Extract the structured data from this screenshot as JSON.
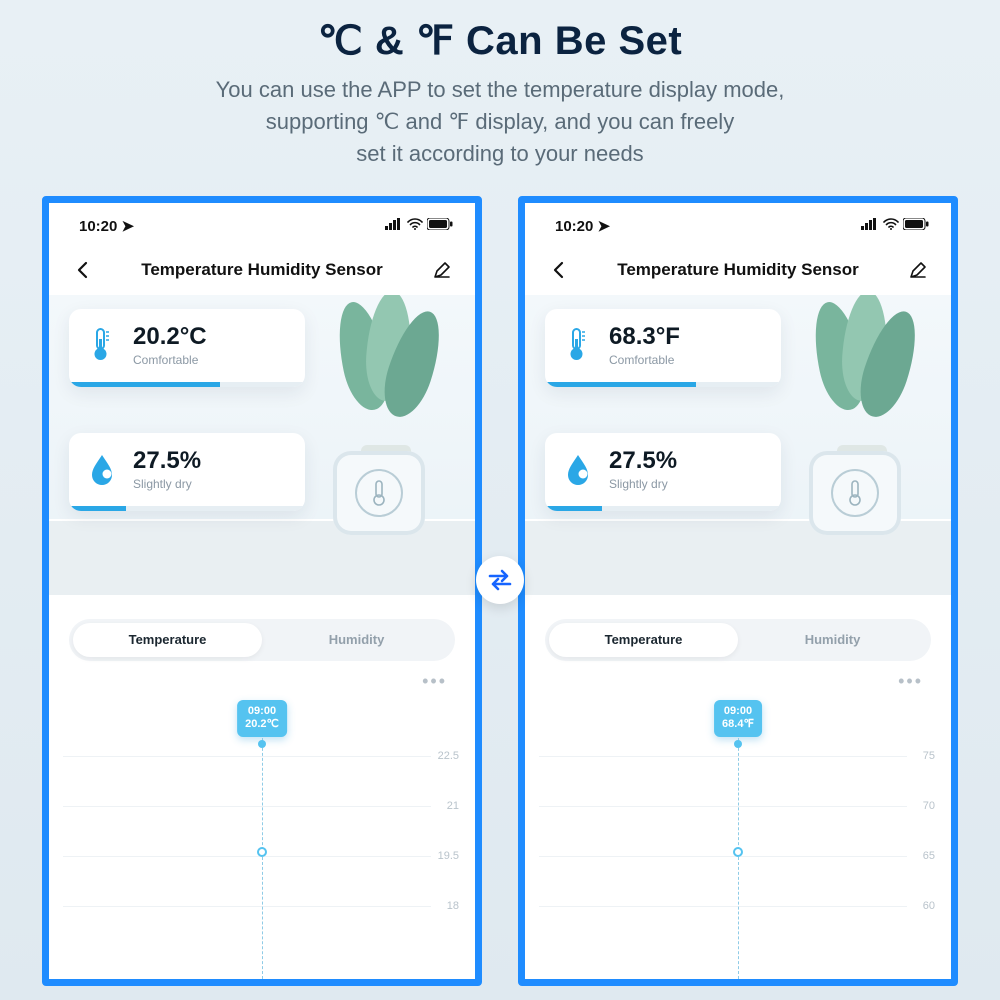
{
  "hero": {
    "title": "℃ & ℉ Can Be Set",
    "line1": "You can use the APP to set the temperature display mode,",
    "line2": "supporting ℃ and ℉ display, and you can freely",
    "line3": "set it according to your needs"
  },
  "status": {
    "time": "10:20"
  },
  "nav": {
    "title": "Temperature Humidity Sensor"
  },
  "tabs": {
    "temperature": "Temperature",
    "humidity": "Humidity"
  },
  "left": {
    "temp_value": "20.2°C",
    "temp_label": "Comfortable",
    "hum_value": "27.5%",
    "hum_label": "Slightly dry",
    "tooltip_time": "09:00",
    "tooltip_value": "20.2℃",
    "y0": "22.5",
    "y1": "21",
    "y2": "19.5",
    "y3": "18"
  },
  "right": {
    "temp_value": "68.3°F",
    "temp_label": "Comfortable",
    "hum_value": "27.5%",
    "hum_label": "Slightly dry",
    "tooltip_time": "09:00",
    "tooltip_value": "68.4℉",
    "y0": "75",
    "y1": "70",
    "y2": "65",
    "y3": "60"
  },
  "colors": {
    "accent": "#1f8cff",
    "chart": "#55c3f0"
  }
}
